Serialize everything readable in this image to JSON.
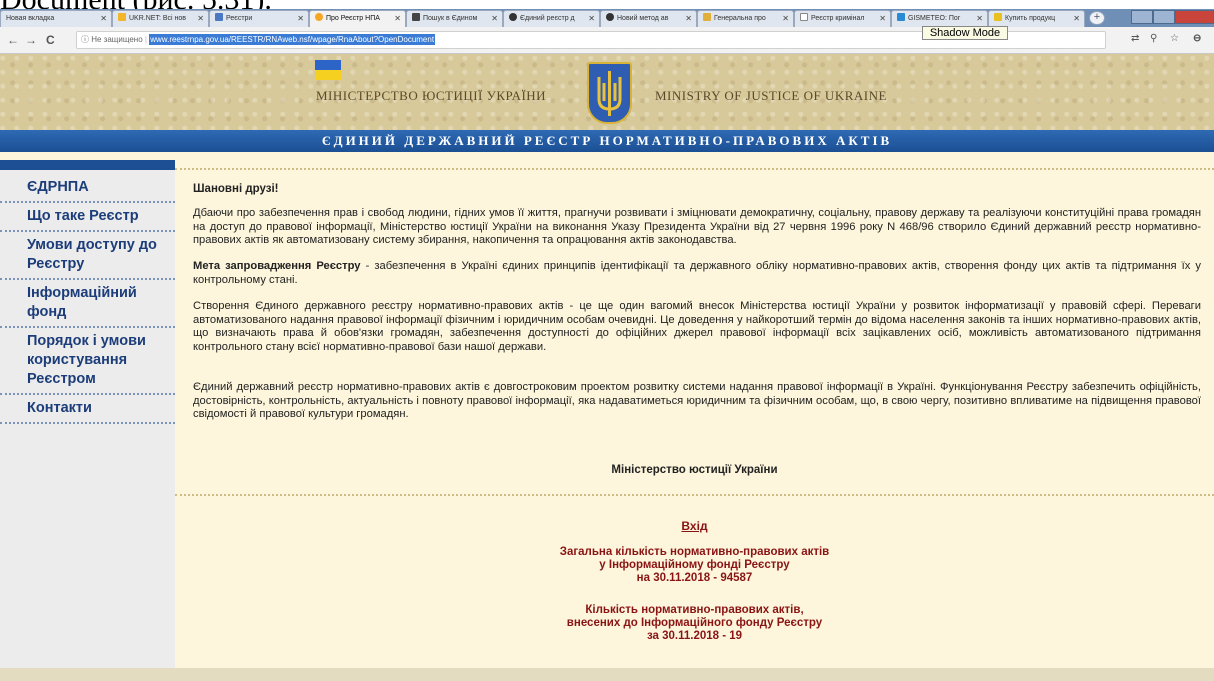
{
  "caption": "Document (рис. 5.31).",
  "browser": {
    "tabs": [
      {
        "label": "Новая вкладка",
        "color": "#dfe6ef",
        "favicon_color": "#dfe6ef"
      },
      {
        "label": "UKR.NET: Всі нов",
        "color": "#dfe6ef",
        "favicon_color": "#f2b52b"
      },
      {
        "label": "Реєстри",
        "color": "#dfe6ef",
        "favicon_color": "#4a78c2"
      },
      {
        "label": "Про Реєстр НПА",
        "color": "#f2f2f2",
        "favicon_color": "#f5a623"
      },
      {
        "label": "Пошук в Єдином",
        "color": "#dfe6ef",
        "favicon_color": "#444444"
      },
      {
        "label": "Єдиний реєстр д",
        "color": "#dfe6ef",
        "favicon_color": "#333333"
      },
      {
        "label": "Новий метод ав",
        "color": "#dfe6ef",
        "favicon_color": "#333333"
      },
      {
        "label": "Генеральна про",
        "color": "#dfe6ef",
        "favicon_color": "#e0b03a"
      },
      {
        "label": "Реєстр кримінал",
        "color": "#dfe6ef",
        "favicon_color": "#ffffff"
      },
      {
        "label": "GISMETEO: Пог",
        "color": "#dfe6ef",
        "favicon_color": "#2a8ad4"
      },
      {
        "label": "Купить продукц",
        "color": "#dfe6ef",
        "favicon_color": "#e8c020"
      }
    ],
    "new_tab": "+",
    "tooltip": "Shadow Mode",
    "back": "←",
    "forward": "→",
    "reload": "C",
    "secure_label": "ⓘ Не защищено",
    "url": "www.reestrnpa.gov.ua/REESTR/RNAweb.nsf/wpage/RnaAbout?OpenDocument",
    "translate_icon": "⇄",
    "zoom_icon": "⚲",
    "star_icon": "☆",
    "menu_icon": "⊖"
  },
  "header": {
    "ministry_uk": "МІНІСТЕРСТВО ЮСТИЦІЇ УКРАЇНИ",
    "ministry_en": "MINISTRY OF JUSTICE OF UKRAINE",
    "band_title": "ЄДИНИЙ ДЕРЖАВНИЙ РЕЄСТР НОРМАТИВНО-ПРАВОВИХ АКТІВ",
    "flag_blue": "#2c64c8",
    "flag_yellow": "#f5d020"
  },
  "sidebar": {
    "items": [
      {
        "label": "ЄДРНПА"
      },
      {
        "label": "Що таке Реєстр"
      },
      {
        "label": "Умови доступу до Реєстру"
      },
      {
        "label": "Інформаційний фонд"
      },
      {
        "label": "Порядок і умови користування Реєстром"
      },
      {
        "label": "Контакти"
      }
    ]
  },
  "content": {
    "greeting": "Шановні друзі!",
    "p1": "Дбаючи про забезпечення прав і свобод людини, гідних умов її життя, прагнучи розвивати і зміцнювати демократичну, соціальну, правову державу та реалізуючи конституційні права громадян на доступ до правової інформації, Міністерство юстиції України на виконання Указу Президента України від 27 червня 1996 року N 468/96 створило Єдиний державний реєстр нормативно-правових актів як автоматизовану систему збирання, накопичення та опрацювання актів законодавства.",
    "p2_bold": "Мета запровадження Реєстру",
    "p2_rest": " - забезпечення в Україні єдиних принципів ідентифікації та державного обліку нормативно-правових актів, створення фонду цих актів та підтримання їх у контрольному стані.",
    "p3": "Створення Єдиного державного реєстру нормативно-правових актів - це ще один вагомий внесок Міністерства юстиції України у розвиток інформатизації у правовій сфері. Переваги автоматизованого надання правової інформації фізичним і юридичним особам очевидні. Це доведення у найкоротший термін до відома населення законів та інших нормативно-правових актів, що визначають права й обов'язки громадян, забезпечення доступності до офіційних джерел правової інформації всіх зацікавлених осіб, можливість автоматизованого підтримання контрольного стану всієї нормативно-правової бази нашої держави.",
    "p4": "Єдиний державний реєстр нормативно-правових актів є довгостроковим проектом розвитку системи надання правової інформації в Україні. Функціонування Реєстру забезпечить офіційність, достовірність, контрольність, актуальність і повноту правової інформації, яка надаватиметься юридичним та фізичним особам, що, в свою чергу, позитивно впливатиме на підвищення правової свідомості й правової культури громадян.",
    "signature": "Міністерство юстиції України",
    "enter": "Вхід",
    "stat1": [
      "Загальна кількість нормативно-правових актів",
      "у Інформаційному фонді Реєстру",
      "на 30.11.2018 - 94587"
    ],
    "stat2": [
      "Кількість нормативно-правових актів,",
      "внесених до Інформаційного фонду Реєстру",
      "за 30.11.2018 - 19"
    ]
  }
}
